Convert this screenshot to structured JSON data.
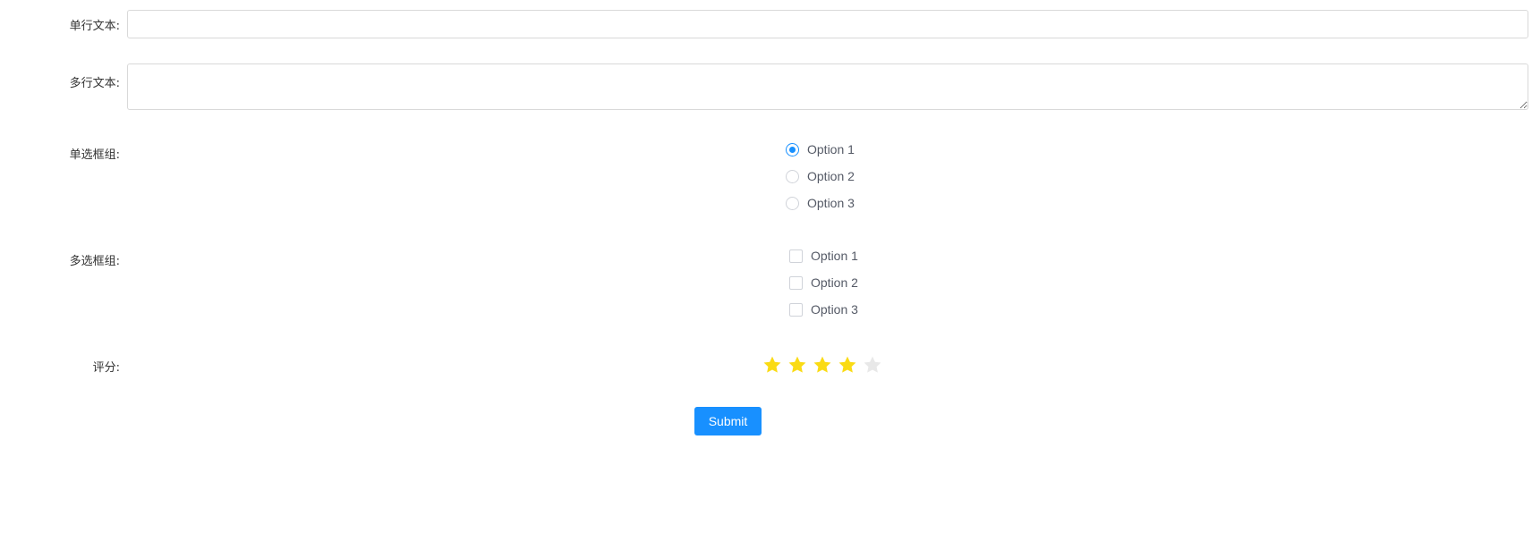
{
  "form": {
    "single_line": {
      "label": "单行文本:",
      "value": "",
      "placeholder": ""
    },
    "multi_line": {
      "label": "多行文本:",
      "value": "",
      "placeholder": ""
    },
    "radio_group": {
      "label": "单选框组:",
      "options": [
        "Option 1",
        "Option 2",
        "Option 3"
      ],
      "selected": "Option 1"
    },
    "checkbox_group": {
      "label": "多选框组:",
      "options": [
        "Option 1",
        "Option 2",
        "Option 3"
      ],
      "checked": []
    },
    "rating": {
      "label": "评分:",
      "value": 4,
      "max": 5
    },
    "submit_label": "Submit"
  },
  "colors": {
    "accent": "#1890ff",
    "star_filled": "#fadb14",
    "star_empty": "#e8e8e8",
    "border": "#d9d9d9"
  }
}
